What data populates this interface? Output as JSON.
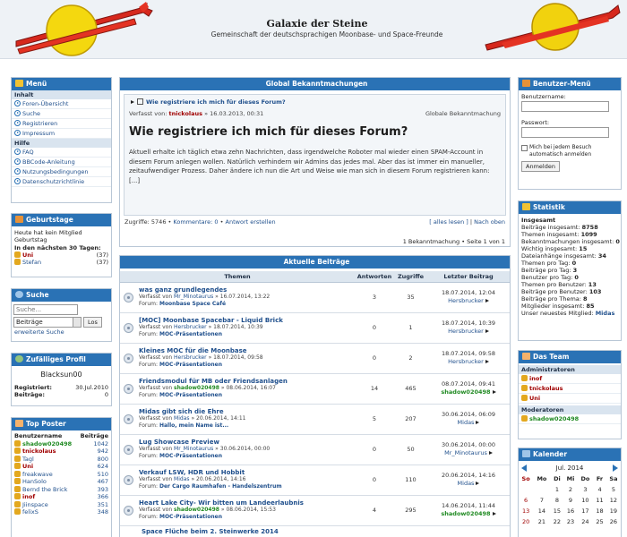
{
  "header": {
    "title": "Galaxie der Steine",
    "subtitle": "Gemeinschaft der deutschsprachigen Moonbase- und Space-Freunde"
  },
  "menu": {
    "title": "Menü",
    "section_inhalt": "Inhalt",
    "inhalt_items": [
      "Foren-Übersicht",
      "Suche",
      "Registrieren",
      "Impressum"
    ],
    "section_hilfe": "Hilfe",
    "hilfe_items": [
      "FAQ",
      "BBCode-Anleitung",
      "Nutzungsbedingungen",
      "Datenschutzrichtlinie"
    ]
  },
  "birthdays": {
    "title": "Geburtstage",
    "today": "Heute hat kein Mitglied Geburtstag",
    "next_label": "In den nächsten 30 Tagen:",
    "list": [
      {
        "name": "Uni",
        "age": "(37)"
      },
      {
        "name": "Stefan",
        "age": "(37)"
      }
    ]
  },
  "search": {
    "title": "Suche",
    "placeholder": "Suche...",
    "select": "Beiträge",
    "go": "Los",
    "advanced": "erweiterte Suche"
  },
  "random_profile": {
    "title": "Zufälliges Profil",
    "name": "Blacksun00",
    "registered_label": "Registriert:",
    "registered_value": "30.Jul.2010",
    "posts_label": "Beiträge:",
    "posts_value": "0"
  },
  "top_poster": {
    "title": "Top Poster",
    "col_user": "Benutzername",
    "col_posts": "Beiträge",
    "rows": [
      {
        "name": "shadow020498",
        "posts": "1042"
      },
      {
        "name": "tnickolaus",
        "posts": "942"
      },
      {
        "name": "Tagl",
        "posts": "800"
      },
      {
        "name": "Uni",
        "posts": "624"
      },
      {
        "name": "freakwave",
        "posts": "510"
      },
      {
        "name": "HanSolo",
        "posts": "467"
      },
      {
        "name": "Bernd the Brick",
        "posts": "393"
      },
      {
        "name": "inof",
        "posts": "366"
      },
      {
        "name": "Jiinspace",
        "posts": "351"
      },
      {
        "name": "felixS",
        "posts": "348"
      }
    ]
  },
  "global": {
    "title": "Global Bekanntmachungen",
    "topic_link": "Wie registriere ich mich für dieses Forum?",
    "by_label": "Verfasst von:",
    "author": "tnickolaus",
    "date": "» 16.03.2013, 00:31",
    "type": "Globale Bekanntmachung",
    "heading": "Wie registriere ich mich für dieses Forum?",
    "body": "Aktuell erhalte ich täglich etwa zehn Nachrichten, dass irgendwelche Roboter mal wieder einen SPAM-Account in diesem Forum anlegen wollen. Natürlich verhindern wir Admins das jedes mal. Aber das ist immer ein manueller, zeitaufwendiger Prozess. Daher ändere ich nun die Art und Weise wie man sich in diesem Forum registrieren kann: [...]",
    "views": "Zugriffe: 5746",
    "comments": "Kommentare: 0",
    "reply": "Antwort erstellen",
    "read_all": "[ alles lesen ]",
    "to_top": "Nach oben",
    "pagination": "1 Bekanntmachung • Seite 1 von 1"
  },
  "latest": {
    "title": "Aktuelle Beiträge",
    "col_topic": "Themen",
    "col_replies": "Antworten",
    "col_views": "Zugriffe",
    "col_last": "Letzter Beitrag",
    "rows": [
      {
        "title": "was ganz grundlegendes",
        "by": "Verfasst von",
        "author": "Mr_Minotaurus",
        "date": "» 16.07.2014, 13:22",
        "forum_label": "Forum:",
        "forum": "Moonbase Space Café",
        "replies": "3",
        "views": "35",
        "last_date": "18.07.2014, 12:04",
        "last_user": "Hersbrucker"
      },
      {
        "title": "[MOC] Moonbase Spacebar - Liquid Brick",
        "by": "Verfasst von",
        "author": "Hersbrucker",
        "date": "» 18.07.2014, 10:39",
        "forum_label": "Forum:",
        "forum": "MOC-Präsentationen",
        "replies": "0",
        "views": "1",
        "last_date": "18.07.2014, 10:39",
        "last_user": "Hersbrucker"
      },
      {
        "title": "Kleines MOC für die Moonbase",
        "by": "Verfasst von",
        "author": "Hersbrucker",
        "date": "» 18.07.2014, 09:58",
        "forum_label": "Forum:",
        "forum": "MOC-Präsentationen",
        "replies": "0",
        "views": "2",
        "last_date": "18.07.2014, 09:58",
        "last_user": "Hersbrucker"
      },
      {
        "title": "Friendsmodul für MB oder Friendsanlagen",
        "by": "Verfasst von",
        "author": "shadow020498",
        "date": "» 08.06.2014, 16:07",
        "forum_label": "Forum:",
        "forum": "MOC-Präsentationen",
        "replies": "14",
        "views": "465",
        "last_date": "08.07.2014, 09:41",
        "last_user": "shadow020498"
      },
      {
        "title": "Midas gibt sich die Ehre",
        "by": "Verfasst von",
        "author": "Midas",
        "date": "» 20.06.2014, 14:11",
        "forum_label": "Forum:",
        "forum": "Hallo, mein Name ist...",
        "replies": "5",
        "views": "207",
        "last_date": "30.06.2014, 06:09",
        "last_user": "Midas"
      },
      {
        "title": "Lug Showcase Preview",
        "by": "Verfasst von",
        "author": "Mr_Minotaurus",
        "date": "» 30.06.2014, 00:00",
        "forum_label": "Forum:",
        "forum": "MOC-Präsentationen",
        "replies": "0",
        "views": "50",
        "last_date": "30.06.2014, 00:00",
        "last_user": "Mr_Minotaurus"
      },
      {
        "title": "Verkauf LSW, HDR und Hobbit",
        "by": "Verfasst von",
        "author": "Midas",
        "date": "» 20.06.2014, 14:16",
        "forum_label": "Forum:",
        "forum": "Der Cargo Raumhafen - Handelszentrum",
        "replies": "0",
        "views": "110",
        "last_date": "20.06.2014, 14:16",
        "last_user": "Midas"
      },
      {
        "title": "Heart Lake City- Wir bitten um Landeerlaubnis",
        "by": "Verfasst von",
        "author": "shadow020498",
        "date": "» 08.06.2014, 15:53",
        "forum_label": "Forum:",
        "forum": "MOC-Präsentationen",
        "replies": "4",
        "views": "295",
        "last_date": "14.06.2014, 11:44",
        "last_user": "shadow020498"
      }
    ],
    "partial_row": "Space Flüche beim 2. Steinwerke 2014"
  },
  "user_menu": {
    "title": "Benutzer-Menü",
    "user_label": "Benutzername:",
    "pass_label": "Passwort:",
    "remember": "Mich bei jedem Besuch automatisch anmelden",
    "login": "Anmelden"
  },
  "stats": {
    "title": "Statistik",
    "lines": [
      {
        "label": "Insgesamt",
        "value": ""
      },
      {
        "label": "Beiträge insgesamt:",
        "value": "8758"
      },
      {
        "label": "Themen insgesamt:",
        "value": "1099"
      },
      {
        "label": "Bekanntmachungen insgesamt:",
        "value": "0"
      },
      {
        "label": "Wichtig insgesamt:",
        "value": "15"
      },
      {
        "label": "Dateianhänge insgesamt:",
        "value": "34"
      },
      {
        "label": "Themen pro Tag:",
        "value": "0"
      },
      {
        "label": "Beiträge pro Tag:",
        "value": "3"
      },
      {
        "label": "Benutzer pro Tag:",
        "value": "0"
      },
      {
        "label": "Themen pro Benutzer:",
        "value": "13"
      },
      {
        "label": "Beiträge pro Benutzer:",
        "value": "103"
      },
      {
        "label": "Beiträge pro Thema:",
        "value": "8"
      },
      {
        "label": "Mitglieder insgesamt:",
        "value": "85"
      },
      {
        "label": "Unser neuestes Mitglied:",
        "value": "Midas"
      }
    ]
  },
  "team": {
    "title": "Das Team",
    "admins_label": "Administratoren",
    "admins": [
      "inof",
      "tnickolaus",
      "Uni"
    ],
    "mods_label": "Moderatoren",
    "mods": [
      "shadow020498"
    ]
  },
  "calendar": {
    "title": "Kalender",
    "month": "Jul. 2014",
    "days": [
      "So",
      "Mo",
      "Di",
      "Mi",
      "Do",
      "Fr",
      "Sa"
    ],
    "weeks": [
      [
        "",
        "",
        "1",
        "2",
        "3",
        "4",
        "5"
      ],
      [
        "6",
        "7",
        "8",
        "9",
        "10",
        "11",
        "12"
      ],
      [
        "13",
        "14",
        "15",
        "16",
        "17",
        "18",
        "19"
      ],
      [
        "20",
        "21",
        "22",
        "23",
        "24",
        "25",
        "26"
      ]
    ]
  },
  "colors": {
    "header_blue": "#2a72b5",
    "green_user": "#208a22",
    "red_user": "#a00000"
  }
}
